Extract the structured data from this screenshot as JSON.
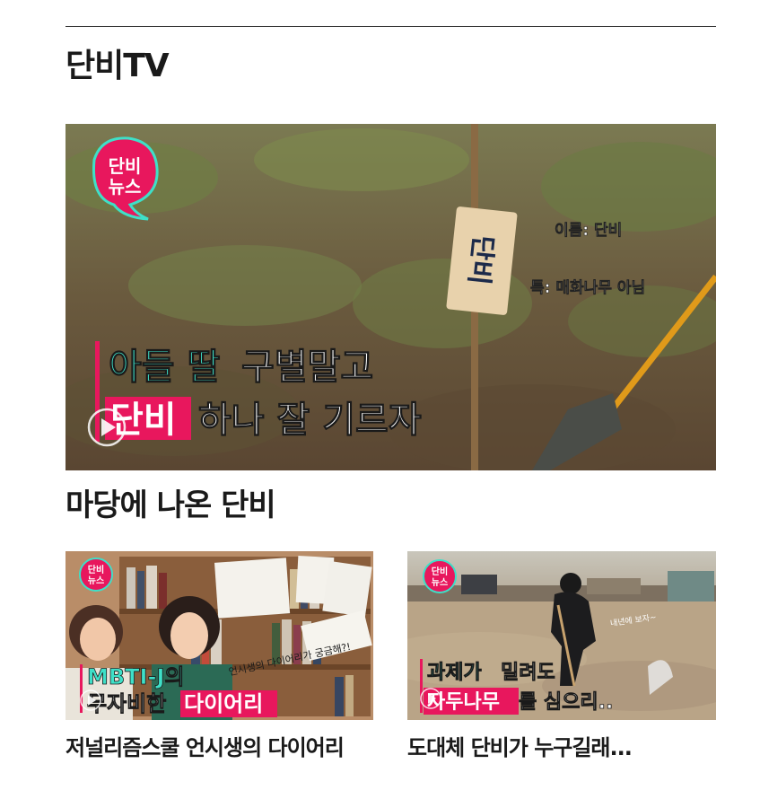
{
  "section_title": "단비TV",
  "featured": {
    "badge_top": "단비",
    "badge_bottom": "뉴스",
    "name_tag": "단비",
    "caption_name": "이름: 단비",
    "caption_trait": "특: 매화나무 아님",
    "headline_line1_highlight": "아들 딸",
    "headline_line1_rest": "구별말고",
    "headline_line2_highlight": "단비",
    "headline_line2_rest": "하나 잘 기르자"
  },
  "sub_section_title": "마당에 나온 단비",
  "cards": [
    {
      "title": "저널리즘스쿨 언시생의 다이어리",
      "badge_top": "단비",
      "badge_bottom": "뉴스",
      "overlay_line1": "MBTI-J의",
      "overlay_line2_plain": "무자비한",
      "overlay_line2_highlight": "다이어리",
      "handwritten_note": "언시생의 다이어리가 궁금해?!"
    },
    {
      "title": "도대체 단비가 누구길래...",
      "badge_top": "단비",
      "badge_bottom": "뉴스",
      "overlay_line1_highlight": "과제가",
      "overlay_line1_rest": "밀려도",
      "overlay_line2_highlight": "자두나무",
      "overlay_line2_rest": "를 심으리..",
      "handwritten_note": "내년에 보자~"
    }
  ],
  "colors": {
    "accent_pink": "#e8175d",
    "accent_mint": "#3ee0c8",
    "text": "#1a1a1a"
  },
  "icons": [
    "play-icon"
  ]
}
